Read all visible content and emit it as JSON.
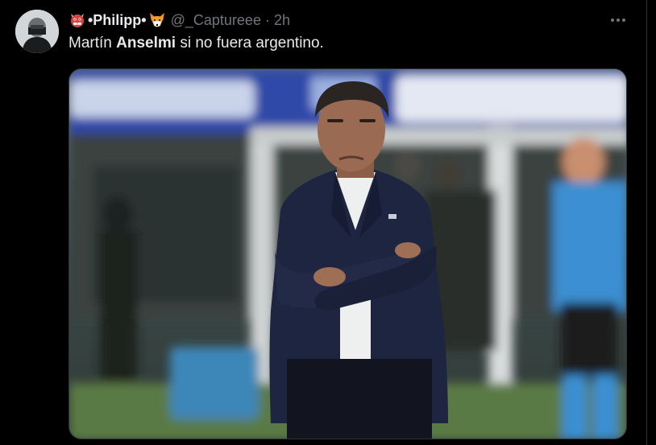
{
  "tweet": {
    "display_name": "•Philipp•",
    "handle": "@_Captureee",
    "separator": "·",
    "time": "2h",
    "text_pre": "Martín ",
    "text_bold": "Anselmi",
    "text_post": " si no fuera argentino.",
    "more_icon": "more-icon",
    "emojis": [
      "ogre-face-emoji",
      "fox-face-emoji"
    ]
  },
  "colors": {
    "background": "#000000",
    "text": "#e7e9ea",
    "secondary": "#71767b",
    "border": "#2f3336"
  }
}
